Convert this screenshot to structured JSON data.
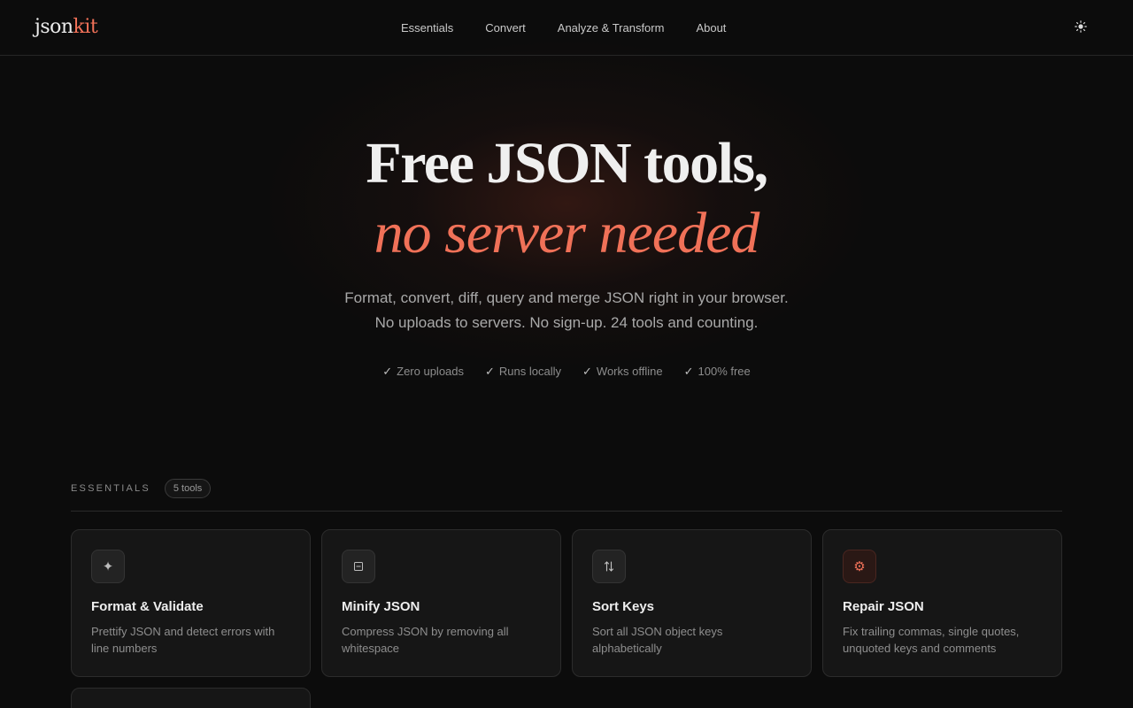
{
  "header": {
    "logo_a": "json",
    "logo_b": "kit",
    "nav": [
      "Essentials",
      "Convert",
      "Analyze & Transform",
      "About"
    ],
    "theme_icon": "sun-icon"
  },
  "hero": {
    "title": "Free JSON tools,",
    "subtitle": "no server needed",
    "desc_line1": "Format, convert, diff, query and merge JSON right in your browser.",
    "desc_line2": "No uploads to servers. No sign-up. 24 tools and counting.",
    "features": [
      "Zero uploads",
      "Runs locally",
      "Works offline",
      "100% free"
    ]
  },
  "section": {
    "label": "ESSENTIALS",
    "count": "5 tools"
  },
  "cards": [
    {
      "icon": "sparkle-icon",
      "title": "Format & Validate",
      "desc": "Prettify JSON and detect errors with line numbers"
    },
    {
      "icon": "compress-icon",
      "title": "Minify JSON",
      "desc": "Compress JSON by removing all whitespace"
    },
    {
      "icon": "sort-icon",
      "title": "Sort Keys",
      "desc": "Sort all JSON object keys alphabetically"
    },
    {
      "icon": "gear-icon",
      "title": "Repair JSON",
      "desc": "Fix trailing commas, single quotes, unquoted keys and comments"
    }
  ],
  "colors": {
    "accent": "#f07158",
    "background": "#0c0c0c",
    "card": "#161616"
  }
}
